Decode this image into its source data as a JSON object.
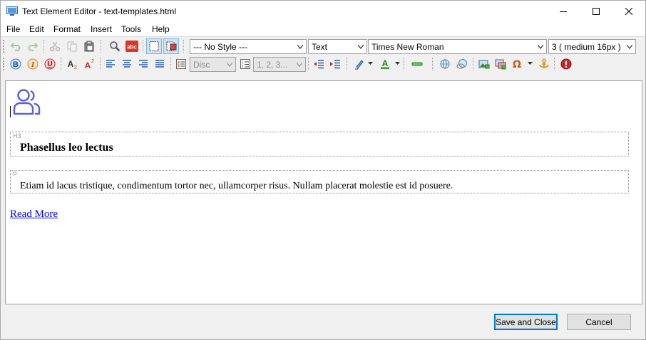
{
  "window": {
    "title": "Text Element Editor - text-templates.html"
  },
  "menu": [
    "File",
    "Edit",
    "Format",
    "Insert",
    "Tools",
    "Help"
  ],
  "toolbar": {
    "style_select": "--- No Style ---",
    "type_select": "Text",
    "font_select": "Times New Roman",
    "size_select": "3 ( medium 16px )",
    "bullet_select": "Disc",
    "numbering_select": "1, 2, 3..."
  },
  "document": {
    "h3_tag": "H3",
    "heading": "Phasellus leo lectus",
    "p_tag": "P",
    "paragraph": "Etiam id lacus tristique, condimentum tortor nec, ullamcorper risus. Nullam placerat molestie est id posuere.",
    "link": "Read More"
  },
  "buttons": {
    "save_close": "Save and Close",
    "cancel": "Cancel"
  },
  "colors": {
    "accent": "#0078d7",
    "link": "#0000ee",
    "users_icon": "#5b5fe0"
  }
}
